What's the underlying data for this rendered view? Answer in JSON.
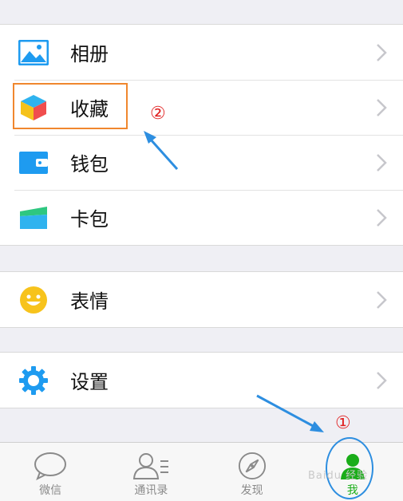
{
  "groups": [
    {
      "items": [
        {
          "label": "相册",
          "icon": "photo-album-icon"
        },
        {
          "label": "收藏",
          "icon": "favorites-cube-icon"
        },
        {
          "label": "钱包",
          "icon": "wallet-icon"
        },
        {
          "label": "卡包",
          "icon": "card-pack-icon"
        }
      ]
    },
    {
      "items": [
        {
          "label": "表情",
          "icon": "emoji-smile-icon"
        }
      ]
    },
    {
      "items": [
        {
          "label": "设置",
          "icon": "settings-gear-icon"
        }
      ]
    }
  ],
  "tabbar": {
    "tabs": [
      {
        "label": "微信",
        "icon": "chat-bubble-icon",
        "active": false
      },
      {
        "label": "通讯录",
        "icon": "contacts-icon",
        "active": false
      },
      {
        "label": "发现",
        "icon": "compass-icon",
        "active": false
      },
      {
        "label": "我",
        "icon": "me-person-icon",
        "active": true
      }
    ]
  },
  "annotations": {
    "step1": "①",
    "step2": "②",
    "watermark": "Baidu 经验"
  },
  "colors": {
    "accent_green": "#1aad19",
    "icon_blue": "#1e9bf0",
    "annotation_orange": "#f0872e",
    "annotation_blue": "#2d8ee0",
    "annotation_red": "#e02020",
    "background": "#efeff4"
  }
}
